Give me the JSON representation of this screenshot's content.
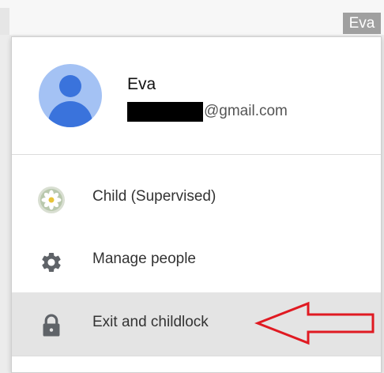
{
  "topbar": {
    "profile_button_label": "Eva"
  },
  "profile": {
    "name": "Eva",
    "email_domain": "@gmail.com",
    "email_redacted": true,
    "avatar_icon": "person-avatar-icon"
  },
  "menu_items": [
    {
      "label": "Child (Supervised)",
      "icon": "daisy-flower-avatar-icon"
    },
    {
      "label": "Manage people",
      "icon": "gear-icon"
    },
    {
      "label": "Exit and childlock",
      "icon": "lock-icon",
      "highlighted": true
    }
  ],
  "annotation": {
    "type": "red-outline-arrow",
    "points_to": "Exit and childlock",
    "color": "#e01a22"
  },
  "colors": {
    "avatar_background": "#a4c2f4",
    "avatar_figure": "#3a73dc",
    "highlight_row": "#e4e4e4",
    "icon_gray": "#5f6368"
  }
}
